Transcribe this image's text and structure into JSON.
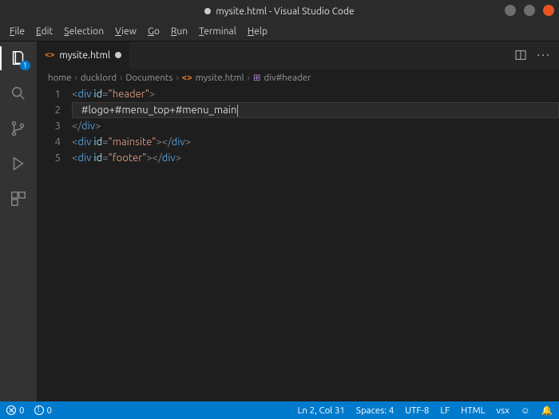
{
  "window": {
    "title_prefix": "● ",
    "filename": "mysite.html",
    "app": "Visual Studio Code"
  },
  "menubar": [
    "File",
    "Edit",
    "Selection",
    "View",
    "Go",
    "Run",
    "Terminal",
    "Help"
  ],
  "activity_badge": "1",
  "tab": {
    "label": "mysite.html"
  },
  "breadcrumb": {
    "parts": [
      "home",
      "ducklord",
      "Documents"
    ],
    "file": "mysite.html",
    "symbol": "div#header"
  },
  "code": {
    "lines": [
      {
        "n": "1",
        "kind": "open",
        "tag": "div",
        "attr": "id",
        "val": "header",
        "indent": 0
      },
      {
        "n": "2",
        "kind": "raw",
        "text": "#logo+#menu_top+#menu_main",
        "indent": 1,
        "cursor": true,
        "hl": true
      },
      {
        "n": "3",
        "kind": "close",
        "tag": "div",
        "indent": 0
      },
      {
        "n": "4",
        "kind": "openclose",
        "tag": "div",
        "attr": "id",
        "val": "mainsite",
        "indent": 0
      },
      {
        "n": "5",
        "kind": "openclose",
        "tag": "div",
        "attr": "id",
        "val": "footer",
        "indent": 0
      }
    ]
  },
  "status": {
    "errors": "0",
    "warnings": "0",
    "ln_col": "Ln 2, Col 31",
    "spaces": "Spaces: 4",
    "encoding": "UTF-8",
    "eol": "LF",
    "lang": "HTML",
    "extra": "vsx"
  }
}
